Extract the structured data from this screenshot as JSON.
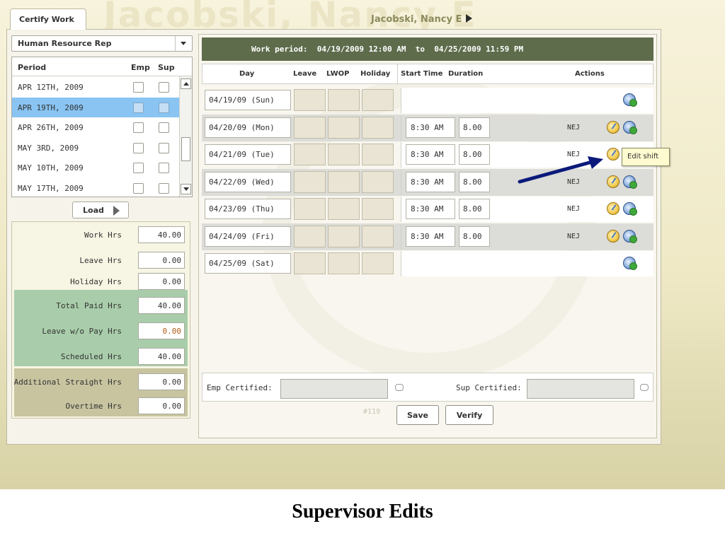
{
  "header": {
    "tab_label": "Certify Work",
    "watermark_name": "Jacobski, Nancy E",
    "employee_name": "Jacobski, Nancy E"
  },
  "left": {
    "role_select": "Human Resource Rep",
    "period_headers": {
      "period": "Period",
      "emp": "Emp",
      "sup": "Sup"
    },
    "periods": [
      {
        "label": "APR 12TH, 2009"
      },
      {
        "label": "APR 19TH, 2009",
        "selected": true
      },
      {
        "label": "APR 26TH, 2009"
      },
      {
        "label": "MAY 3RD, 2009"
      },
      {
        "label": "MAY 10TH, 2009"
      },
      {
        "label": "MAY 17TH, 2009"
      }
    ],
    "load_label": "Load",
    "summary": [
      {
        "label": "Work Hrs",
        "value": "40.00"
      },
      {
        "label": "Leave Hrs",
        "value": "0.00"
      },
      {
        "label": "Holiday Hrs",
        "value": "0.00"
      },
      {
        "label": "Total Paid Hrs",
        "value": "40.00"
      },
      {
        "label": "Leave w/o Pay Hrs",
        "value": "0.00"
      },
      {
        "label": "Scheduled Hrs",
        "value": "40.00"
      },
      {
        "label": "Additional Straight Hrs",
        "value": "0.00"
      },
      {
        "label": "Overtime Hrs",
        "value": "0.00"
      }
    ]
  },
  "grid": {
    "work_period": "Work period:  04/19/2009 12:00 AM  to  04/25/2009 11:59 PM",
    "headers": {
      "day": "Day",
      "leave": "Leave",
      "lwop": "LWOP",
      "holiday": "Holiday",
      "start_time": "Start Time",
      "duration": "Duration",
      "actions": "Actions"
    },
    "rows": [
      {
        "day": "04/19/09 (Sun)"
      },
      {
        "day": "04/20/09 (Mon)",
        "start": "8:30 AM",
        "duration": "8.00",
        "initials": "NEJ"
      },
      {
        "day": "04/21/09 (Tue)",
        "start": "8:30 AM",
        "duration": "8.00",
        "initials": "NEJ"
      },
      {
        "day": "04/22/09 (Wed)",
        "start": "8:30 AM",
        "duration": "8.00",
        "initials": "NEJ"
      },
      {
        "day": "04/23/09 (Thu)",
        "start": "8:30 AM",
        "duration": "8.00",
        "initials": "NEJ"
      },
      {
        "day": "04/24/09 (Fri)",
        "start": "8:30 AM",
        "duration": "8.00",
        "initials": "NEJ"
      },
      {
        "day": "04/25/09 (Sat)"
      }
    ],
    "tooltip": "Edit shift"
  },
  "footer": {
    "emp_certified_label": "Emp Certified:",
    "sup_certified_label": "Sup Certified:",
    "record_number": "#119",
    "save_label": "Save",
    "verify_label": "Verify"
  },
  "icons": {
    "edit_shift": "edit-clock-icon",
    "add_shift": "add-clock-icon",
    "comment": "speech-bubble-icon"
  },
  "caption": "Supervisor Edits"
}
